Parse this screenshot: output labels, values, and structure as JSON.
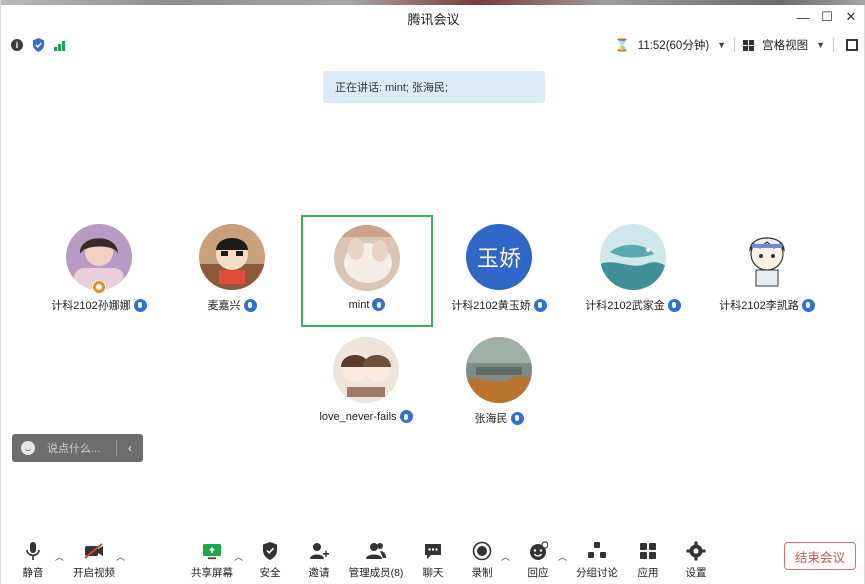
{
  "window": {
    "title": "腾讯会议",
    "controls": {
      "minimize": "—",
      "maximize": "☐",
      "close": "✕"
    }
  },
  "infobar": {
    "timer": "11:52(60分钟)",
    "view": "宫格视图"
  },
  "speaking_banner": "正在讲话: mint; 张海民;",
  "participants": [
    {
      "name": "计科2102孙娜娜",
      "avatar": "photo-girl",
      "host": true
    },
    {
      "name": "麦嘉兴",
      "avatar": "cartoon-shinchan"
    },
    {
      "name": "mint",
      "avatar": "photo-plush",
      "active": true
    },
    {
      "name": "计科2102黄玉娇",
      "avatar": "text",
      "avatar_text": "玉娇",
      "avatar_color": "#2f66c8"
    },
    {
      "name": "计科2102武家金",
      "avatar": "illustration-whale"
    },
    {
      "name": "计科2102李凯路",
      "avatar": "cartoon-boy"
    },
    {
      "name": "love_never-fails",
      "avatar": "cartoon-couple"
    },
    {
      "name": "张海民",
      "avatar": "photo-landscape"
    }
  ],
  "chat": {
    "placeholder": "说点什么...",
    "collapse_icon": "‹"
  },
  "toolbar": {
    "mute": "静音",
    "video": "开启视频",
    "share": "共享屏幕",
    "security": "安全",
    "invite": "邀请",
    "members": "管理成员(8)",
    "chat": "聊天",
    "record": "录制",
    "reaction": "回应",
    "breakout": "分组讨论",
    "apps": "应用",
    "settings": "设置",
    "end": "结束会议"
  },
  "colors": {
    "active_border": "#2db65b",
    "mic_badge": "#2f6fd6",
    "banner_bg": "#dbe9f8",
    "end_button": "#d9534f"
  }
}
